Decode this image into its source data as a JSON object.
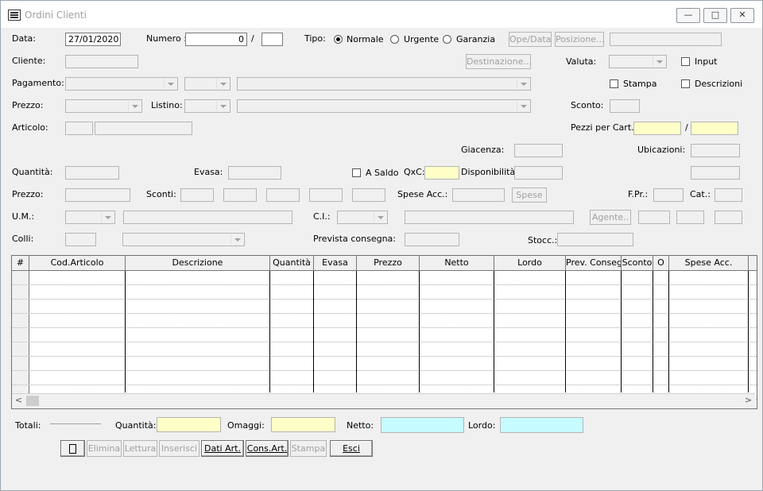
{
  "window": {
    "title": "Ordini Clienti",
    "minimize": "—",
    "maximize": "□",
    "close": "✕"
  },
  "header": {
    "data_label": "Data:",
    "data_value": "27/01/2020",
    "numero_label": "Numero :",
    "numero_value": "0",
    "numero_sep": "/",
    "tipo_label": "Tipo:",
    "tipo_options": [
      "Normale",
      "Urgente",
      "Garanzia"
    ],
    "tipo_selected": "Normale",
    "ope_data_btn": "Ope/Data",
    "posizione_btn": "Posizione..."
  },
  "cliente": {
    "label": "Cliente:",
    "destinazione_btn": "Destinazione...",
    "valuta_label": "Valuta:",
    "input_label": "Input"
  },
  "pagamento": {
    "label": "Pagamento:",
    "stampa_label": "Stampa",
    "descrizioni_label": "Descrizioni"
  },
  "prezzo_row": {
    "label": "Prezzo:",
    "listino_label": "Listino:",
    "sconto_label": "Sconto:"
  },
  "articolo": {
    "label": "Articolo:",
    "pezzi_label": "Pezzi per Cart..:",
    "pezzi_sep": "/"
  },
  "giacenza": {
    "label": "Giacenza:",
    "ubicazioni_label": "Ubicazioni:"
  },
  "quantita": {
    "label": "Quantità:",
    "evasa_label": "Evasa:",
    "asaldo_label": "A Saldo",
    "qxc_label": "QxC:",
    "disponibilita_label": "Disponibilità:"
  },
  "prezzo2": {
    "label": "Prezzo:",
    "sconti_label": "Sconti:",
    "spese_acc_label": "Spese Acc.:",
    "spese_btn": "Spese",
    "fpr_label": "F.Pr.:",
    "cat_label": "Cat.:"
  },
  "um": {
    "label": "U.M.:",
    "ci_label": "C.I.:",
    "agente_btn": "Agente.."
  },
  "colli": {
    "label": "Colli:",
    "prevista_label": "Prevista consegna:",
    "stocc_label": "Stocc.:"
  },
  "grid": {
    "columns": [
      "#",
      "Cod.Articolo",
      "Descrizione",
      "Quantità",
      "Evasa",
      "Prezzo",
      "Netto",
      "Lordo",
      "Prev. Consegn",
      "Sconto",
      "O",
      "Spese Acc."
    ],
    "scroll_left": "<",
    "scroll_right": ">"
  },
  "totali": {
    "label": "Totali:",
    "quantita_label": "Quantità:",
    "omaggi_label": "Omaggi:",
    "netto_label": "Netto:",
    "lordo_label": "Lordo:"
  },
  "toolbar": {
    "elimina": "Elimina",
    "lettura": "Lettura",
    "inserisci": "Inserisci",
    "dati_art": "Dati Art.",
    "cons_art": "Cons.Art.",
    "stampa": "Stampa",
    "esci": "Esci"
  }
}
